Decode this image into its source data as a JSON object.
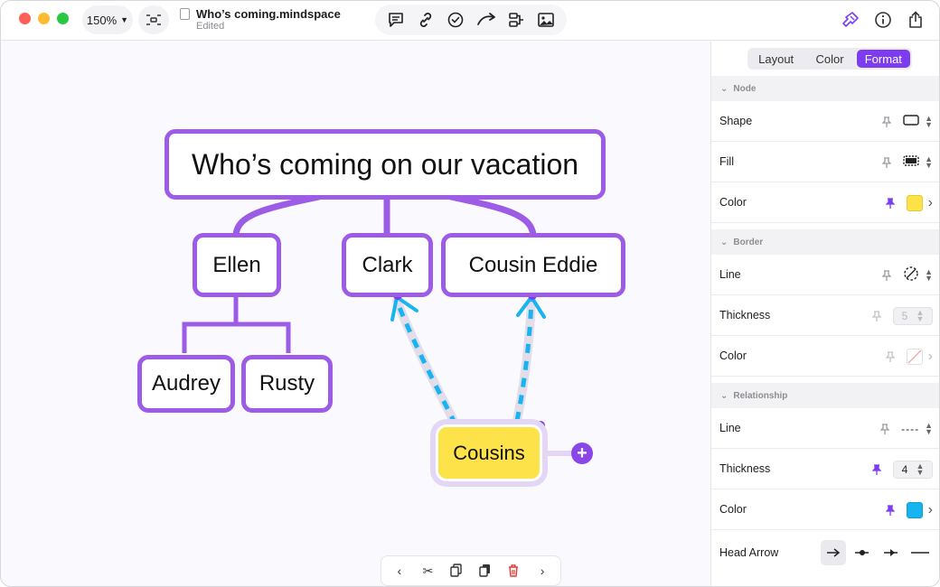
{
  "window": {
    "zoom": "150%",
    "file_title": "Who’s coming.mindspace",
    "file_status": "Edited"
  },
  "toolbar": {
    "tools": [
      "comment-icon",
      "link-icon",
      "task-icon",
      "relationship-icon",
      "structure-icon",
      "image-icon"
    ],
    "right": [
      "format-brush-icon",
      "info-icon",
      "share-icon"
    ]
  },
  "mindmap": {
    "root": "Who’s coming on our vacation",
    "nodes": {
      "ellen": "Ellen",
      "clark": "Clark",
      "cousin_eddie": "Cousin Eddie",
      "audrey": "Audrey",
      "rusty": "Rusty",
      "cousins": "Cousins"
    },
    "colors": {
      "branch": "#9c5ce6",
      "relationship": "#18b4ef",
      "selected_fill": "#fde24a"
    }
  },
  "inspector": {
    "tabs": [
      {
        "label": "Layout",
        "active": false
      },
      {
        "label": "Color",
        "active": false
      },
      {
        "label": "Format",
        "active": true
      }
    ],
    "sections": {
      "node": "Node",
      "border": "Border",
      "relationship": "Relationship"
    },
    "node": {
      "shape_label": "Shape",
      "fill_label": "Fill",
      "color_label": "Color",
      "color_value": "#fde24a"
    },
    "border": {
      "line_label": "Line",
      "thickness_label": "Thickness",
      "thickness_value": "5",
      "color_label": "Color"
    },
    "relationship": {
      "line_label": "Line",
      "line_value": "----",
      "thickness_label": "Thickness",
      "thickness_value": "4",
      "color_label": "Color",
      "color_value": "#18b4ef",
      "head_arrow_label": "Head Arrow"
    }
  }
}
